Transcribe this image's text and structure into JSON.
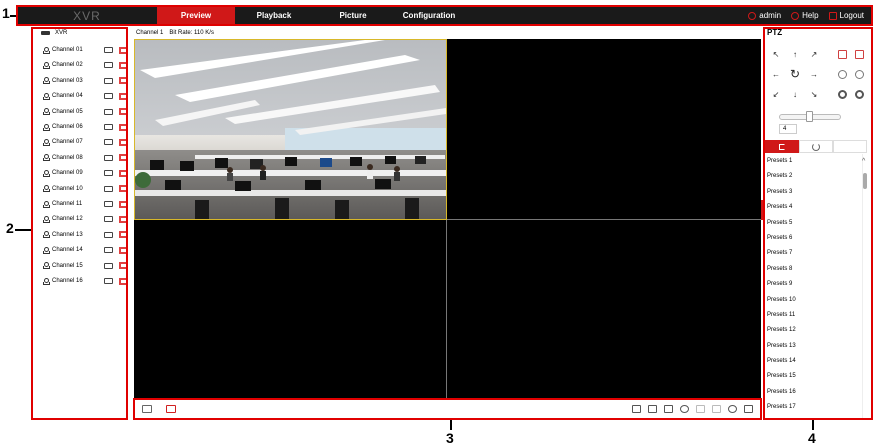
{
  "annotations": {
    "n1": "1",
    "n2": "2",
    "n3": "3",
    "n4": "4"
  },
  "topbar": {
    "logo": "XVR",
    "tabs": [
      {
        "label": "Preview",
        "active": true
      },
      {
        "label": "Playback",
        "active": false
      },
      {
        "label": "Picture",
        "active": false
      },
      {
        "label": "Configuration",
        "active": false
      }
    ],
    "user": "admin",
    "help": "Help",
    "logout": "Logout"
  },
  "left": {
    "device": "XVR",
    "channels": [
      "Channel 01",
      "Channel 02",
      "Channel 03",
      "Channel 04",
      "Channel 05",
      "Channel 06",
      "Channel 07",
      "Channel 08",
      "Channel 09",
      "Channel 10",
      "Channel 11",
      "Channel 12",
      "Channel 13",
      "Channel 14",
      "Channel 15",
      "Channel 16"
    ]
  },
  "video": {
    "channel": "Channel 1",
    "bitrate": "Bit Rate: 110 K/s"
  },
  "ptz": {
    "title": "PTZ",
    "directions": [
      "↖",
      "↑",
      "↗",
      "←",
      "↻",
      "→",
      "↙",
      "↓",
      "↘"
    ],
    "speed": "4",
    "presets": [
      "Presets 1",
      "Presets 2",
      "Presets 3",
      "Presets 4",
      "Presets 5",
      "Presets 6",
      "Presets 7",
      "Presets 8",
      "Presets 9",
      "Presets 10",
      "Presets 11",
      "Presets 12",
      "Presets 13",
      "Presets 14",
      "Presets 15",
      "Presets 16",
      "Presets 17"
    ]
  },
  "colors": {
    "accent": "#d01818",
    "frame": "#e00000",
    "topbar": "#1a1a1a"
  }
}
